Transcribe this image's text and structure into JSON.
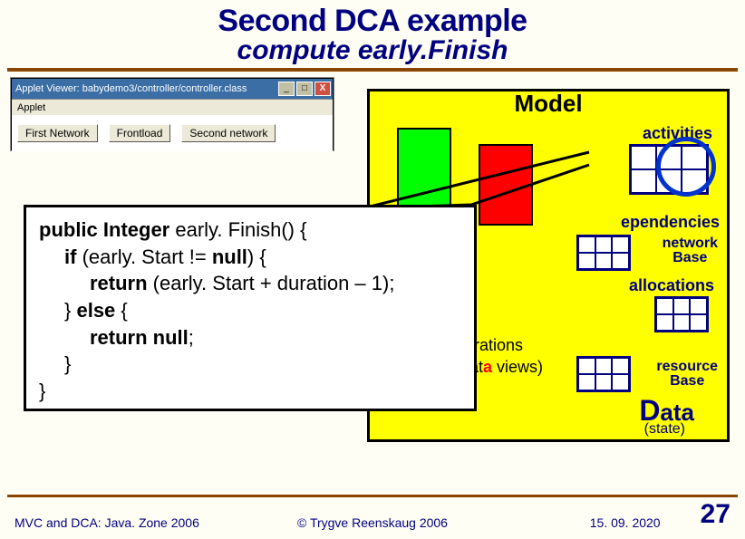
{
  "title": "Second DCA example",
  "subtitle": "compute early.Finish",
  "model": {
    "title": "Model",
    "labels": {
      "activities": "activities",
      "dependencies": "ependencies",
      "network_base_l1": "network",
      "network_base_l2": "Base",
      "allocations": "allocations",
      "resource_base_l1": "resource",
      "resource_base_l2": "Base",
      "collaborations": "orations",
      "collab_sub_prefix": " dat",
      "collab_sub_suffix": " views)",
      "data_word": "ata",
      "data_initial": "D",
      "state": "(state)"
    }
  },
  "applet": {
    "titlebar": "Applet Viewer: babydemo3/controller/controller.class",
    "sub": "Applet",
    "buttons": {
      "first": "First Network",
      "frontload": "Frontload",
      "second": "Second network"
    },
    "win_min": "_",
    "win_max": "□",
    "win_close": "X"
  },
  "code": {
    "l1a": "public",
    "l1b": " Integer",
    "l1c": " early. Finish() {",
    "l2a": "if",
    "l2b": " (early. Start != ",
    "l2c": "null",
    "l2d": ") {",
    "l3a": "return",
    "l3b": " (early. Start + duration – 1);",
    "l4a": "} ",
    "l4b": "else",
    "l4c": " {",
    "l5a": "return null",
    "l5b": ";",
    "l6": "}",
    "l7": "}"
  },
  "footer": {
    "left": "MVC and DCA: Java. Zone 2006",
    "center": "© Trygve Reenskaug 2006",
    "date": "15. 09. 2020",
    "page": "27"
  }
}
